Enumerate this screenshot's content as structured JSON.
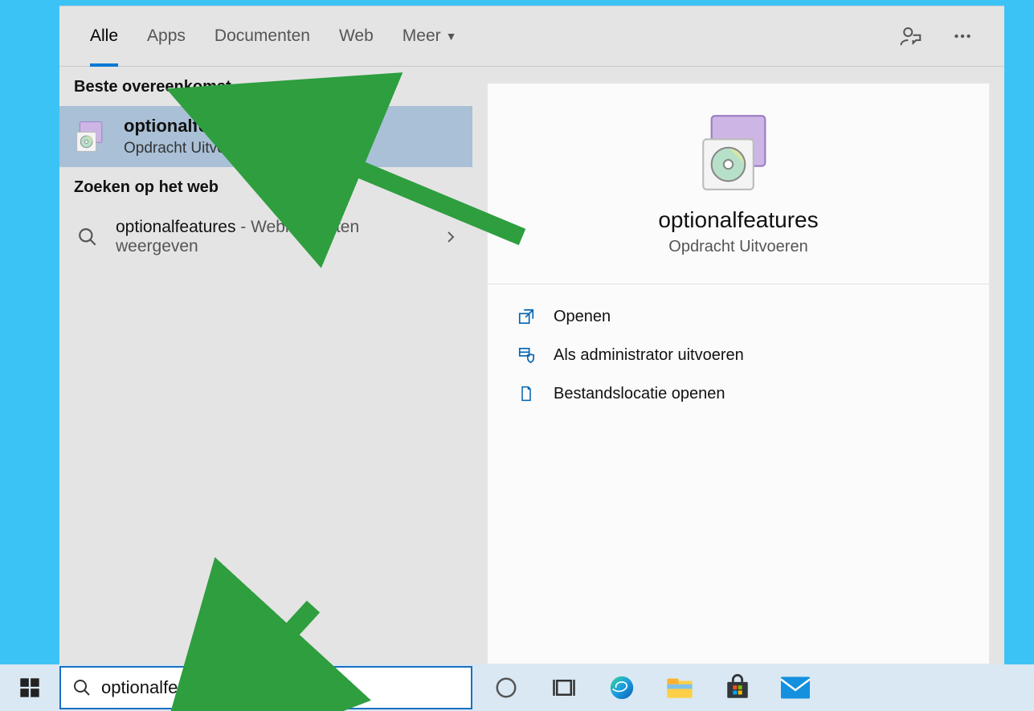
{
  "tabs": {
    "all": "Alle",
    "apps": "Apps",
    "documents": "Documenten",
    "web": "Web",
    "more": "Meer"
  },
  "left": {
    "best_match_header": "Beste overeenkomst",
    "best_match": {
      "title": "optionalfeatures",
      "subtitle": "Opdracht Uitvoeren"
    },
    "web_header": "Zoeken op het web",
    "web_result_term": "optionalfeatures",
    "web_result_suffix": " - Webresultaten weergeven"
  },
  "detail": {
    "title": "optionalfeatures",
    "subtitle": "Opdracht Uitvoeren",
    "actions": {
      "open": "Openen",
      "run_admin": "Als administrator uitvoeren",
      "open_location": "Bestandslocatie openen"
    }
  },
  "search": {
    "value": "optionalfeatures"
  }
}
